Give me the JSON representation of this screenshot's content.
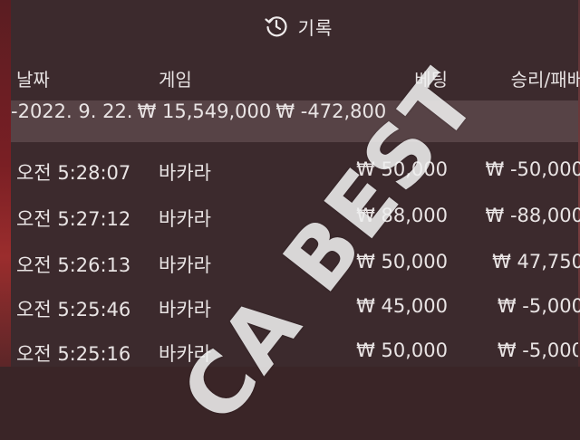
{
  "header": {
    "title": "기록",
    "icon": "history-clock-icon"
  },
  "columns": {
    "date": "날짜",
    "game": "게임",
    "bet": "베팅",
    "result": "승리/패배"
  },
  "summary": {
    "date": "-2022. 9. 22.",
    "bet": "₩ 15,549,000",
    "result": "₩ -472,800"
  },
  "rows": [
    {
      "time": "오전 5:28:07",
      "game": "바카라",
      "bet": "₩ 50,000",
      "result": "₩ -50,000"
    },
    {
      "time": "오전 5:27:12",
      "game": "바카라",
      "bet": "₩ 88,000",
      "result": "₩ -88,000"
    },
    {
      "time": "오전 5:26:13",
      "game": "바카라",
      "bet": "₩ 50,000",
      "result": "₩ 47,750"
    },
    {
      "time": "오전 5:25:46",
      "game": "바카라",
      "bet": "₩ 45,000",
      "result": "₩ -5,000"
    },
    {
      "time": "오전 5:25:16",
      "game": "바카라",
      "bet": "₩ 50,000",
      "result": "₩ -5,000"
    }
  ],
  "watermark": "CA BEST"
}
